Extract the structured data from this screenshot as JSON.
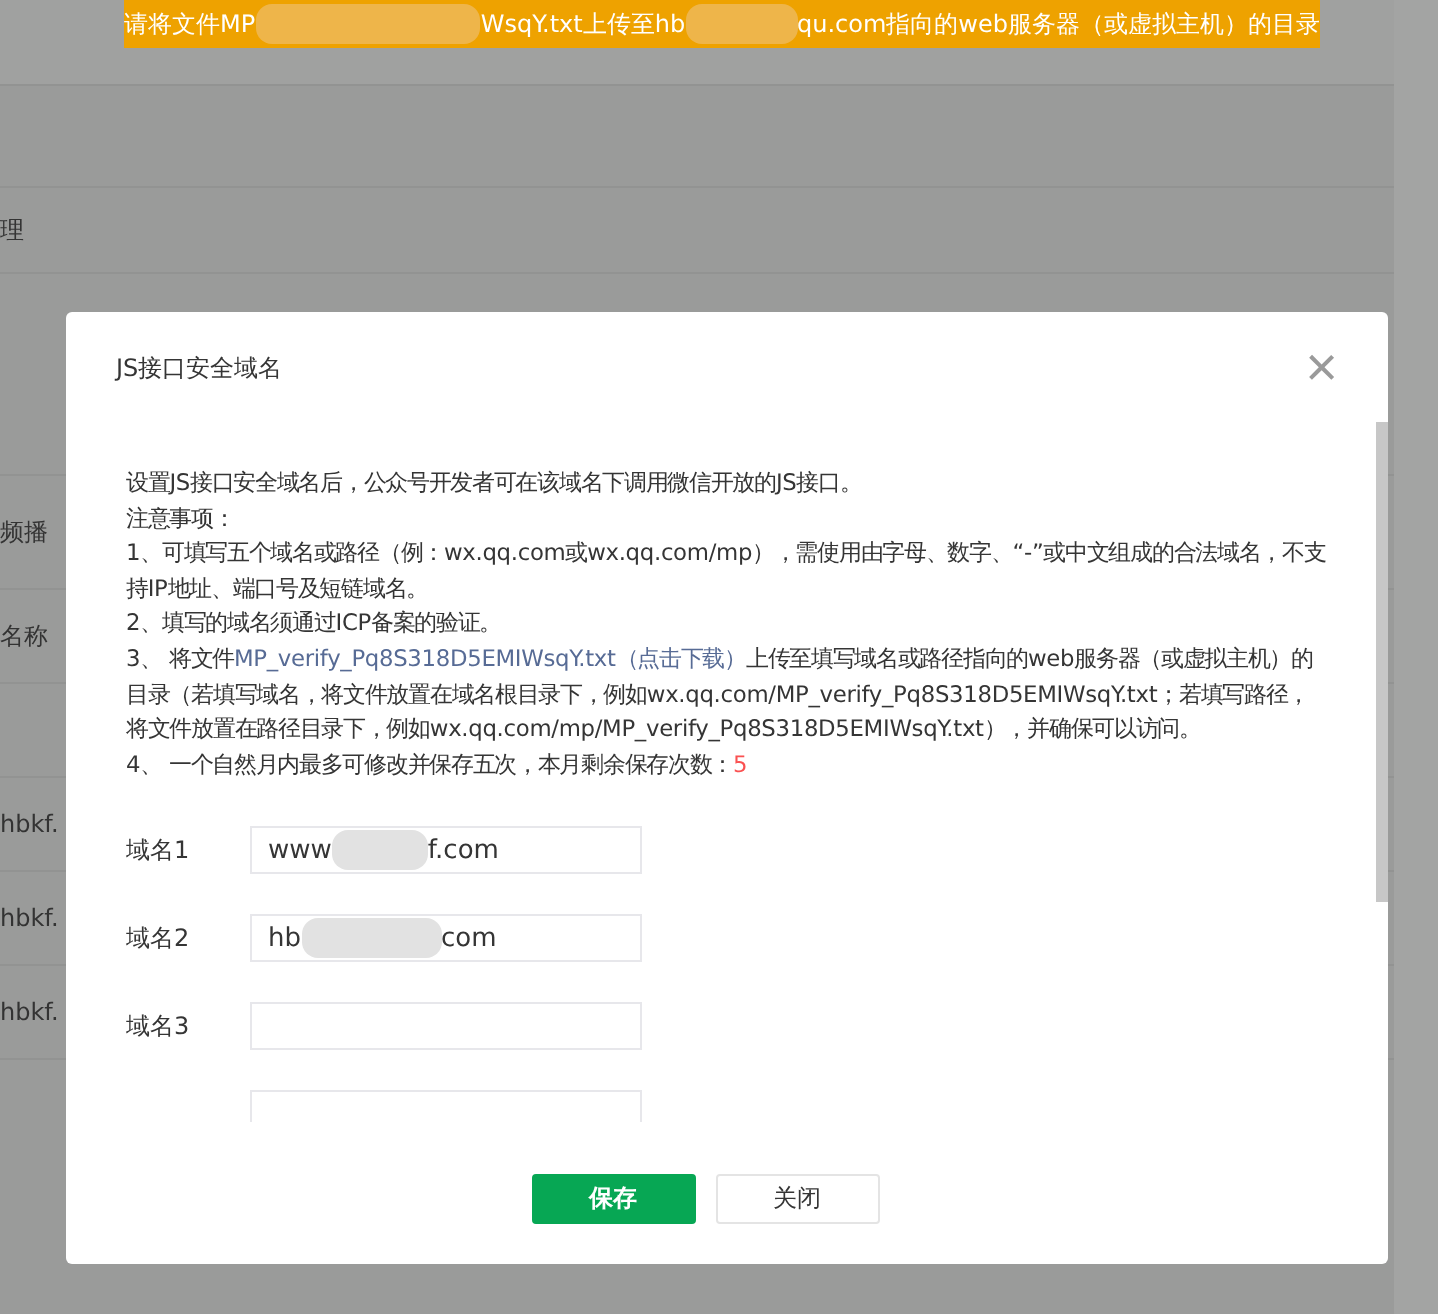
{
  "banner": {
    "parts": [
      "请将文件MP",
      "WsqY.txt上传至hb",
      "qu.com指向的web服务器（或虚拟主机）的目录"
    ]
  },
  "background": {
    "header": "理",
    "rows": [
      {
        "kind": "spacer"
      },
      {
        "kind": "text",
        "text": "频播"
      },
      {
        "kind": "text",
        "text": "名称"
      },
      {
        "kind": "spacer"
      },
      {
        "kind": "text",
        "text": "hbkf."
      },
      {
        "kind": "text",
        "text": "hbkf."
      },
      {
        "kind": "text",
        "text": "hbkf."
      }
    ]
  },
  "dialog": {
    "title": "JS接口安全域名",
    "close": "×",
    "intro": "设置JS接口安全域名后，公众号开发者可在该域名下调用微信开放的JS接口。",
    "notes_heading": "注意事项：",
    "notes": [
      {
        "kind": "text",
        "text": "1、可填写五个域名或路径（例：wx.qq.com或wx.qq.com/mp），需使用由字母、数字、“-”或中文组成的合法域名，不支持IP地址、端口号及短链域名。"
      },
      {
        "kind": "text",
        "text": "2、填写的域名须通过ICP备案的验证。"
      },
      {
        "kind": "link",
        "before": "3、 将文件",
        "link": "MP_verify_Pq8S318D5EMIWsqY.txt（点击下载）",
        "after": "上传至填写域名或路径指向的web服务器（或虚拟主机）的目录（若填写域名，将文件放置在域名根目录下，例如wx.qq.com/MP_verify_Pq8S318D5EMIWsqY.txt；若填写路径，将文件放置在路径目录下，例如wx.qq.com/mp/MP_verify_Pq8S318D5EMIWsqY.txt），并确保可以访问。"
      },
      {
        "kind": "count",
        "text": "4、 一个自然月内最多可修改并保存五次，本月剩余保存次数：",
        "count": "5"
      }
    ],
    "domains": [
      {
        "kind": "field",
        "label": "域名1",
        "value_parts": [
          "www",
          "f.com"
        ]
      },
      {
        "kind": "field",
        "label": "域名2",
        "value_parts": [
          "hb",
          "com"
        ]
      },
      {
        "kind": "field",
        "label": "域名3"
      },
      {
        "kind": "clipped"
      }
    ],
    "buttons": [
      {
        "kind": "primary",
        "label": "保存"
      },
      {
        "kind": "secondary",
        "label": "关闭"
      }
    ]
  }
}
